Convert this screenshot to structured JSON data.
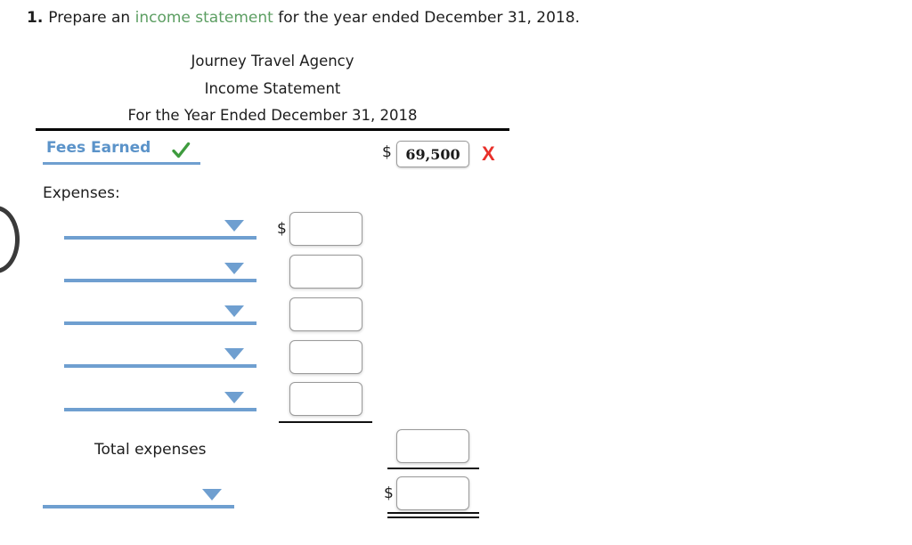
{
  "question": {
    "number": "1.",
    "text_before": "Prepare an ",
    "link_text": "income statement",
    "text_after": " for the year ended December 31, 2018."
  },
  "statement": {
    "company": "Journey Travel Agency",
    "title": "Income Statement",
    "period": "For the Year Ended December 31, 2018"
  },
  "revenue": {
    "label": "Fees Earned",
    "label_status": "correct",
    "check_icon": "check-icon",
    "dollar_sign": "$",
    "value": "69,500",
    "value_status": "incorrect",
    "cross_icon": "X"
  },
  "expenses": {
    "section_label": "Expenses:",
    "dollar_sign": "$",
    "rows": [
      {
        "account": "",
        "placeholder": "",
        "amount": "",
        "amount_placeholder": ""
      },
      {
        "account": "",
        "placeholder": "",
        "amount": "",
        "amount_placeholder": ""
      },
      {
        "account": "",
        "placeholder": "",
        "amount": "",
        "amount_placeholder": ""
      },
      {
        "account": "",
        "placeholder": "",
        "amount": "",
        "amount_placeholder": ""
      },
      {
        "account": "",
        "placeholder": "",
        "amount": "",
        "amount_placeholder": ""
      }
    ],
    "total_label": "Total expenses",
    "total_value": "",
    "total_placeholder": ""
  },
  "net_income": {
    "account": "",
    "account_placeholder": "",
    "dollar_sign": "$",
    "value": "",
    "value_placeholder": ""
  },
  "colors": {
    "link_green": "#5c9e62",
    "select_blue": "#6f9fd0",
    "label_blue": "#5b93c9",
    "check_green": "#3e9b3e",
    "cross_red": "#e8302a",
    "rule_black": "#000000"
  }
}
